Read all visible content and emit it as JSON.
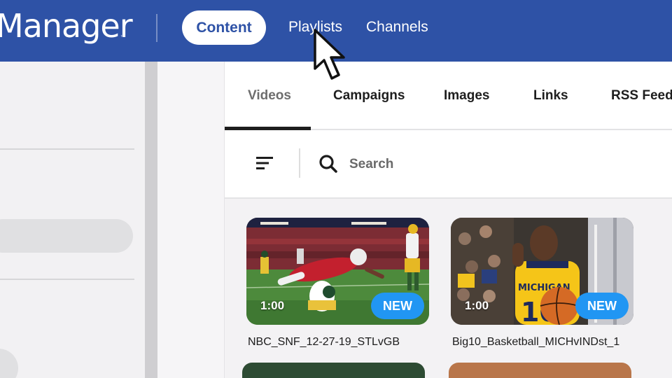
{
  "header": {
    "logo": "Manager",
    "logo_tm": "™",
    "nav": {
      "active": "Content",
      "playlists": "Playlists",
      "channels": "Channels"
    },
    "colors": {
      "bar": "#2e52a6",
      "pill": "#ffffff"
    }
  },
  "tabs": [
    {
      "label": "Videos",
      "selected": true
    },
    {
      "label": "Campaigns"
    },
    {
      "label": "Images"
    },
    {
      "label": "Links"
    },
    {
      "label": "RSS Feeds"
    }
  ],
  "toolbar": {
    "filter_icon": "filter-lines-icon",
    "search_icon": "search-icon",
    "search_placeholder": "Search"
  },
  "videos": [
    {
      "title": "NBC_SNF_12-27-19_STLvGB",
      "duration": "1:00",
      "badge": "NEW"
    },
    {
      "title": "Big10_Basketball_MICHvINDst_1",
      "duration": "1:00",
      "badge": "NEW"
    }
  ],
  "badge_color": "#2196f3",
  "cursor": "arrow-pointer-icon"
}
